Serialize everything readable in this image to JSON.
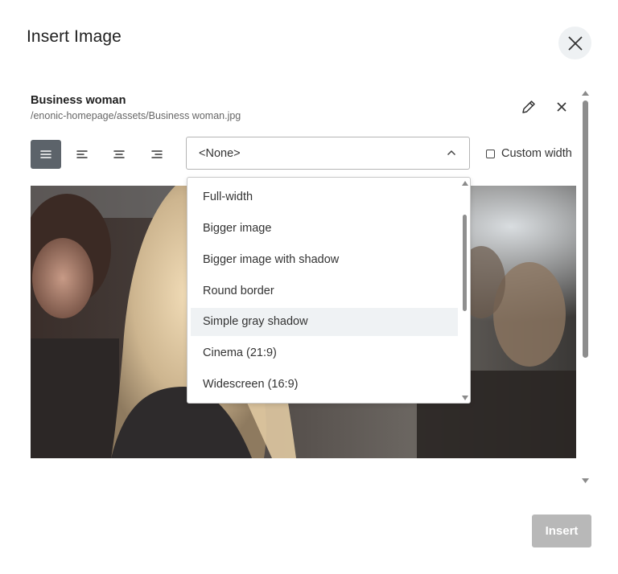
{
  "dialog": {
    "title": "Insert Image"
  },
  "image": {
    "title": "Business woman",
    "path": "/enonic-homepage/assets/Business woman.jpg",
    "alt_description": "Business woman"
  },
  "toolbar": {
    "alignment_buttons": [
      "justify",
      "left",
      "center",
      "right"
    ],
    "selected_alignment": "justify",
    "style_select_value": "<None>",
    "custom_width_label": "Custom width",
    "custom_width_checked": false
  },
  "style_options": [
    "Full-width",
    "Bigger image",
    "Bigger image with shadow",
    "Round border",
    "Simple gray shadow",
    "Cinema (21:9)",
    "Widescreen (16:9)"
  ],
  "hovered_option": "Simple gray shadow",
  "footer": {
    "insert_label": "Insert"
  },
  "icons": {
    "close": "close-icon",
    "edit": "pencil-icon",
    "remove": "x-icon",
    "select_caret": "chevron-up-icon"
  },
  "colors": {
    "active_align_bg": "#5c636a",
    "insert_disabled_bg": "#b8b8b8",
    "hover_bg": "#eff2f4"
  }
}
